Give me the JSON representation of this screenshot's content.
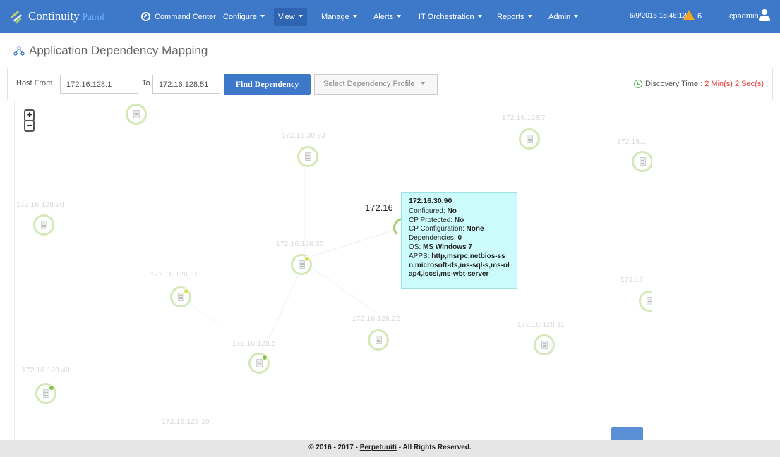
{
  "brand": {
    "name": "Continuity",
    "sub": "Patrol"
  },
  "nav": {
    "command_center": "Command Center",
    "items": [
      {
        "label": "Configure",
        "active": false
      },
      {
        "label": "View",
        "active": true
      },
      {
        "label": "Manage",
        "active": false
      },
      {
        "label": "Alerts",
        "active": false
      },
      {
        "label": "IT Orchestration",
        "active": false
      },
      {
        "label": "Reports",
        "active": false
      },
      {
        "label": "Admin",
        "active": false
      }
    ],
    "datetime": "6/9/2016 15:46:13",
    "alert_count": "6",
    "user": "cpadmin"
  },
  "page": {
    "title": "Application Dependency Mapping"
  },
  "toolbar": {
    "host_from_label": "Host From",
    "host_from_value": "172.16.128.1",
    "to_label": "To",
    "to_value": "172.16.128.51",
    "find_button": "Find Dependency",
    "profile_placeholder": "Select Dependency Profile",
    "discovery_label": "Discovery Time :",
    "discovery_value": "2 Min(s) 2 Sec(s)"
  },
  "map": {
    "zoom_in": "+",
    "zoom_out": "−",
    "hover_label": "172.16",
    "nodes": [
      {
        "label": ""
      },
      {
        "label": "172.16.30.93"
      },
      {
        "label": "172.16.128.7"
      },
      {
        "label": "172.16.1"
      },
      {
        "label": "172.16.128.30"
      },
      {
        "label": "172.16.128.35"
      },
      {
        "label": "172.16.128.31"
      },
      {
        "label": "172.16"
      },
      {
        "label": "172.16.128.22"
      },
      {
        "label": "172.16.128.11"
      },
      {
        "label": "172.16.128.5"
      },
      {
        "label": "172.16.128.40"
      },
      {
        "label": "172.16.128.10"
      }
    ],
    "floating_label": "172.16.128.13"
  },
  "tooltip": {
    "ip": "172.16.30.90",
    "configured_label": "Configured:",
    "configured_value": "No",
    "protected_label": "CP Protected:",
    "protected_value": "No",
    "configuration_label": "CP Configuration:",
    "configuration_value": "None",
    "dependencies_label": "Dependencies:",
    "dependencies_value": "0",
    "os_label": "OS:",
    "os_value": "MS Windows 7",
    "apps_label": "APPS:",
    "apps_value": "http,msrpc,netbios-ssn,microsoft-ds,ms-sql-s,ms-olap4,iscsi,ms-wbt-server"
  },
  "footer": {
    "prefix": "© 2016 - 2017 -",
    "company": "Perpetuuiti",
    "suffix": "- All Rights Reserved."
  }
}
